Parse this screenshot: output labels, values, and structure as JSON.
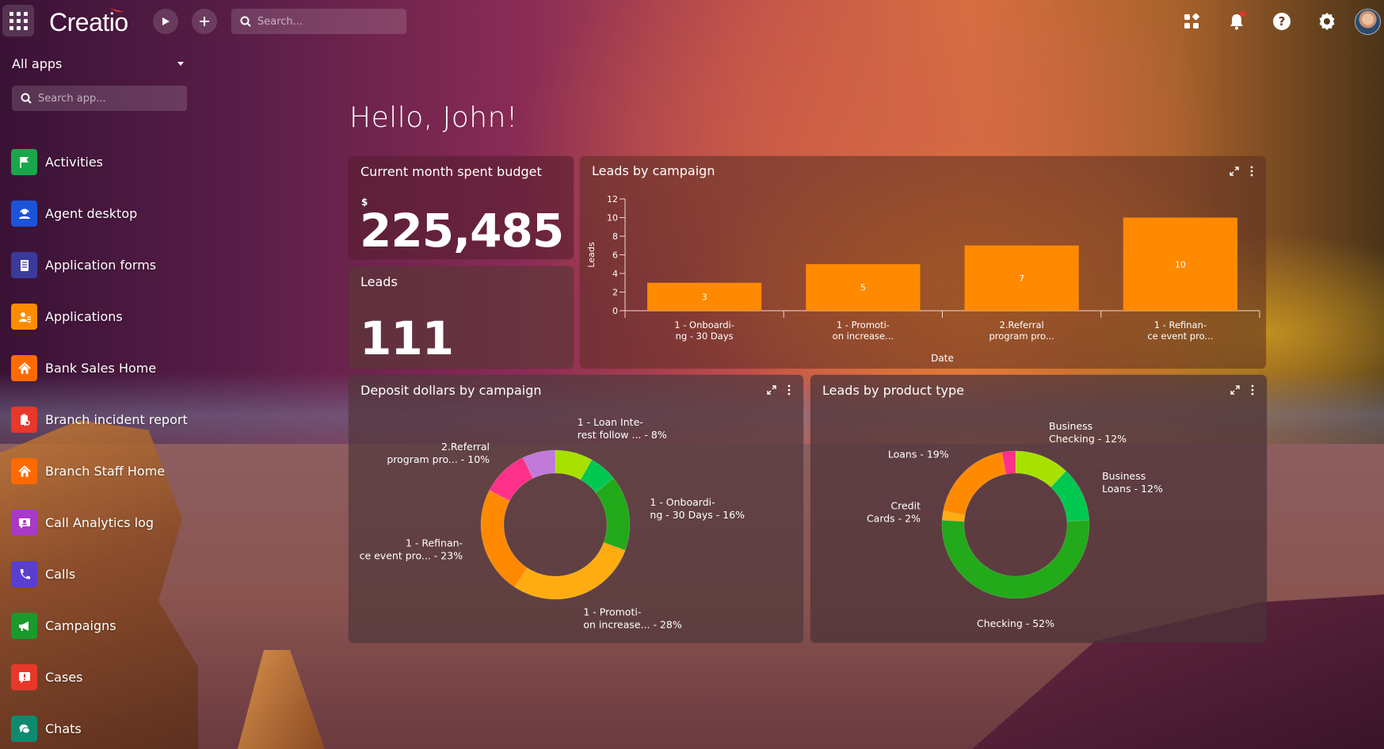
{
  "topbar": {
    "logo": "Creatio",
    "search_placeholder": "Search...",
    "notification_badge": true
  },
  "sidebar": {
    "selector_label": "All apps",
    "search_placeholder": "Search app...",
    "items": [
      {
        "label": "Activities",
        "icon": "flag-icon",
        "color": "#1aa64a"
      },
      {
        "label": "Agent desktop",
        "icon": "agent-icon",
        "color": "#1c54d8"
      },
      {
        "label": "Application forms",
        "icon": "form-icon",
        "color": "#3b3a9c"
      },
      {
        "label": "Applications",
        "icon": "applicant-icon",
        "color": "#ff8c00"
      },
      {
        "label": "Bank Sales Home",
        "icon": "home-icon",
        "color": "#ff6a00"
      },
      {
        "label": "Branch incident report",
        "icon": "clipboard-search-icon",
        "color": "#e8382a"
      },
      {
        "label": "Branch Staff Home",
        "icon": "home-icon",
        "color": "#ff6a00"
      },
      {
        "label": "Call Analytics log",
        "icon": "contact-card-icon",
        "color": "#a83ac8"
      },
      {
        "label": "Calls",
        "icon": "phone-icon",
        "color": "#5a3ed0"
      },
      {
        "label": "Campaigns",
        "icon": "megaphone-icon",
        "color": "#1a9a2a"
      },
      {
        "label": "Cases",
        "icon": "alert-message-icon",
        "color": "#e8382a"
      },
      {
        "label": "Chats",
        "icon": "chat-icon",
        "color": "#0f8a6e"
      }
    ]
  },
  "main": {
    "greeting": "Hello, John!",
    "budget": {
      "title": "Current month spent budget",
      "currency": "$",
      "value": "225,485"
    },
    "leads": {
      "title": "Leads",
      "value": "111"
    },
    "colors": {
      "bar": "#ff8a00"
    }
  },
  "chart_data": [
    {
      "type": "bar",
      "title": "Leads by campaign",
      "xlabel": "Date",
      "ylabel": "Leads",
      "categories": [
        [
          "1 - Onboardi-",
          "ng - 30 Days"
        ],
        [
          "1 - Promoti-",
          "on increase..."
        ],
        [
          "2.Referral",
          "program pro..."
        ],
        [
          "1 - Refinan-",
          "ce event pro..."
        ]
      ],
      "values": [
        3,
        5,
        7,
        10
      ],
      "ylim": [
        0,
        12
      ],
      "yticks": [
        0,
        2,
        4,
        6,
        8,
        10,
        12
      ],
      "grid": false,
      "color": "#ff8a00"
    },
    {
      "type": "pie",
      "donut": true,
      "title": "Deposit dollars by campaign",
      "slices": [
        {
          "label": [
            "1 - Loan Inte-",
            "rest follow ... - 8%"
          ],
          "value": 8,
          "color": "#a8e000",
          "labeled": true,
          "anchor": "start"
        },
        {
          "label": [],
          "value": 6,
          "color": "#00c850",
          "labeled": false
        },
        {
          "label": [
            "1 - Onboardi-",
            "ng - 30 Days - 16%"
          ],
          "value": 16,
          "color": "#22aa1a",
          "labeled": true,
          "anchor": "start"
        },
        {
          "label": [
            "1 - Promoti-",
            "on increase... - 28%"
          ],
          "value": 28,
          "color": "#ffac10",
          "labeled": true,
          "anchor": "start"
        },
        {
          "label": [
            "1 - Refinan-",
            "ce event pro... - 23%"
          ],
          "value": 23,
          "color": "#ff8a00",
          "labeled": true,
          "anchor": "end"
        },
        {
          "label": [
            "2.Referral",
            "program pro... - 10%"
          ],
          "value": 10,
          "color": "#ff3088",
          "labeled": true,
          "anchor": "end"
        },
        {
          "label": [],
          "value": 7,
          "color": "#c07ad8",
          "labeled": false
        }
      ]
    },
    {
      "type": "pie",
      "donut": true,
      "title": "Leads by product type",
      "slices": [
        {
          "label": [
            "Business",
            "Checking - 12%"
          ],
          "value": 12,
          "color": "#a8e000",
          "labeled": true,
          "anchor": "start"
        },
        {
          "label": [
            "Business",
            "Loans - 12%"
          ],
          "value": 12,
          "color": "#00c850",
          "labeled": true,
          "anchor": "start"
        },
        {
          "label": [
            "Checking - 52%"
          ],
          "value": 52,
          "color": "#22aa1a",
          "labeled": true,
          "anchor": "middle"
        },
        {
          "label": [
            "Credit",
            "Cards - 2%"
          ],
          "value": 2,
          "color": "#ffac10",
          "labeled": true,
          "anchor": "end"
        },
        {
          "label": [
            "Loans - 19%"
          ],
          "value": 19,
          "color": "#ff8a00",
          "labeled": true,
          "anchor": "end"
        },
        {
          "label": [],
          "value": 3,
          "color": "#ff3088",
          "labeled": false
        }
      ]
    }
  ]
}
